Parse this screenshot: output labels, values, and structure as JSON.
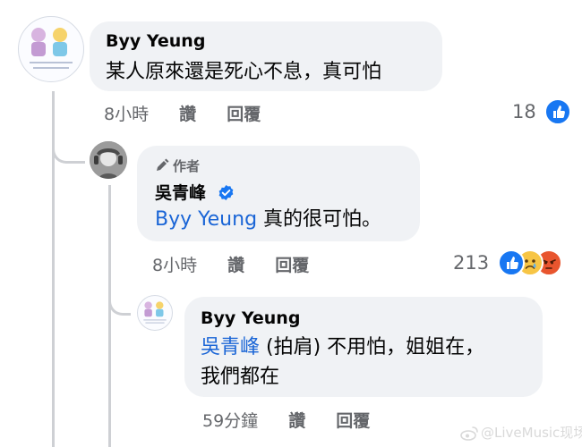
{
  "comments": [
    {
      "author": "Byy Yeung",
      "text": "某人原來還是死心不息，真可怕",
      "time": "8小時",
      "like_label": "讚",
      "reply_label": "回覆",
      "reaction_count": "18",
      "reactions": [
        "like-reaction"
      ]
    },
    {
      "author_tag": "作者",
      "author": "吳青峰",
      "verified": true,
      "mention": "Byy Yeung",
      "text": " 真的很可怕。",
      "time": "8小時",
      "like_label": "讚",
      "reply_label": "回覆",
      "reaction_count": "213",
      "reactions": [
        "like-reaction",
        "sad-reaction",
        "angry-reaction"
      ]
    },
    {
      "author": "Byy Yeung",
      "mention": "吳青峰",
      "text_line1": " (拍肩) 不用怕，姐姐在，",
      "text_line2": "我們都在",
      "time": "59分鐘",
      "like_label": "讚",
      "reply_label": "回覆"
    }
  ],
  "watermark": "@LiveMusic现场",
  "colors": {
    "bubble": "#f0f2f5",
    "mention": "#1a65d6",
    "meta_text": "#65676b",
    "like_blue": "#1877f2",
    "thread_line": "#ced0d4"
  }
}
